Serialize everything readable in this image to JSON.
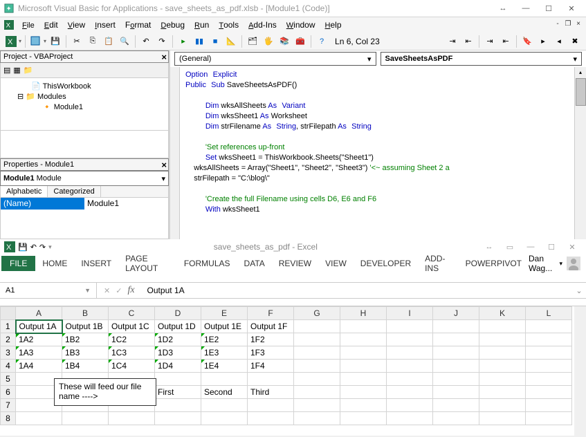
{
  "vba": {
    "title": "Microsoft Visual Basic for Applications - save_sheets_as_pdf.xlsb - [Module1 (Code)]",
    "menu": [
      "File",
      "Edit",
      "View",
      "Insert",
      "Format",
      "Debug",
      "Run",
      "Tools",
      "Add-Ins",
      "Window",
      "Help"
    ],
    "status": "Ln 6, Col 23",
    "project_panel_title": "Project - VBAProject",
    "tree": {
      "thisworkbook": "ThisWorkbook",
      "modules": "Modules",
      "module1": "Module1"
    },
    "props_panel_title": "Properties - Module1",
    "props_combo": "Module1 Module",
    "tabs": {
      "a": "Alphabetic",
      "c": "Categorized"
    },
    "prop_name_key": "(Name)",
    "prop_name_val": "Module1",
    "combo_left": "(General)",
    "combo_right": "SaveSheetsAsPDF",
    "code": {
      "l1a": "Option",
      "l1b": "Explicit",
      "l2a": "Public",
      "l2b": "Sub",
      "l2c": " SaveSheetsAsPDF()",
      "l3a": "Dim",
      "l3b": " wksAllSheets ",
      "l3c": "As",
      "l3d": "Variant",
      "l4a": "Dim",
      "l4b": " wksSheet1 ",
      "l4c": "As",
      "l4d": " Worksheet",
      "l5a": "Dim",
      "l5b": " strFilename ",
      "l5c": "As",
      "l5d": "String",
      "l5e": ", strFilepath ",
      "l5f": "As",
      "l5g": "String",
      "l6": "'Set references up-front",
      "l7a": "Set",
      "l7b": " wksSheet1 = ThisWorkbook.Sheets(\"Sheet1\")",
      "l8a": "    wksAllSheets = Array(\"Sheet1\", \"Sheet2\", \"Sheet3\") ",
      "l8b": "'<~ assuming Sheet 2 a",
      "l9": "    strFilepath = \"C:\\blog\\\"",
      "l10": "'Create the full Filename using cells D6, E6 and F6",
      "l11a": "With",
      "l11b": " wksSheet1"
    }
  },
  "excel": {
    "title": "save_sheets_as_pdf - Excel",
    "ribbon": [
      "FILE",
      "HOME",
      "INSERT",
      "PAGE LAYOUT",
      "FORMULAS",
      "DATA",
      "REVIEW",
      "VIEW",
      "DEVELOPER",
      "ADD-INS",
      "POWERPIVOT"
    ],
    "user": "Dan Wag...",
    "namebox": "A1",
    "formula": "Output 1A",
    "cols": [
      "A",
      "B",
      "C",
      "D",
      "E",
      "F",
      "G",
      "H",
      "I",
      "J",
      "K",
      "L"
    ],
    "rows": {
      "r1": [
        "Output 1A",
        "Output 1B",
        "Output 1C",
        "Output 1D",
        "Output 1E",
        "Output 1F",
        "",
        "",
        "",
        "",
        "",
        ""
      ],
      "r2": [
        "1A2",
        "1B2",
        "1C2",
        "1D2",
        "1E2",
        "1F2",
        "",
        "",
        "",
        "",
        "",
        ""
      ],
      "r3": [
        "1A3",
        "1B3",
        "1C3",
        "1D3",
        "1E3",
        "1F3",
        "",
        "",
        "",
        "",
        "",
        ""
      ],
      "r4": [
        "1A4",
        "1B4",
        "1C4",
        "1D4",
        "1E4",
        "1F4",
        "",
        "",
        "",
        "",
        "",
        ""
      ],
      "r5": [
        "",
        "",
        "",
        "",
        "",
        "",
        "",
        "",
        "",
        "",
        "",
        ""
      ],
      "r6": [
        "",
        "",
        "",
        "First",
        "Second",
        "Third",
        "",
        "",
        "",
        "",
        "",
        ""
      ],
      "r7": [
        "",
        "",
        "",
        "",
        "",
        "",
        "",
        "",
        "",
        "",
        "",
        ""
      ],
      "r8": [
        "",
        "",
        "",
        "",
        "",
        "",
        "",
        "",
        "",
        "",
        "",
        ""
      ]
    },
    "callout": "These will feed our file name ---->"
  }
}
